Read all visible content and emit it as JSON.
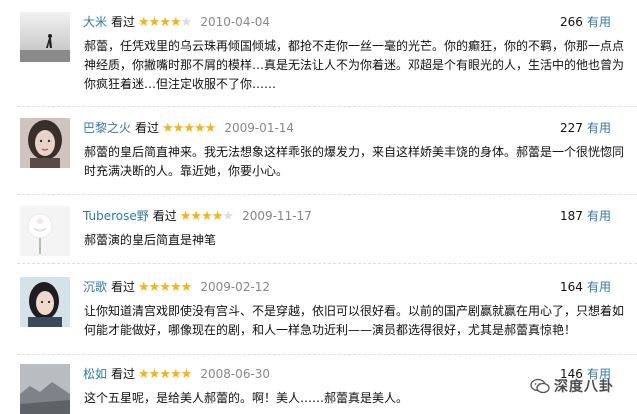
{
  "colors": {
    "link": "#3377aa",
    "star": "#f5b31b",
    "date": "#888888"
  },
  "reviews": [
    {
      "user": "大米",
      "seen": "看过",
      "stars": "★★★★",
      "stars_off": "★",
      "date": "2010-04-04",
      "votes": "266",
      "useful": "有用",
      "text": "郝蕾，任凭戏里的乌云珠再倾国倾城，都抢不走你一丝一毫的光芒。你的癫狂，你的不羁，你那一点点神经质，你撇嘴时那不屑的模样…真是无法让人不为你着迷。邓超是个有眼光的人，生活中的他也曾为你疯狂着迷…但注定收服不了你……",
      "avatar_icon": "person-silhouette-icon"
    },
    {
      "user": "巴黎之火",
      "seen": "看过",
      "stars": "★★★★★",
      "stars_off": "",
      "date": "2009-01-14",
      "votes": "227",
      "useful": "有用",
      "text": "郝蕾的皇后简直神来。我无法想象这样乖张的爆发力，来自这样娇美丰饶的身体。郝蕾是一个很恍惚同时充满决断的人。靠近她，你要小心。",
      "avatar_icon": "woman-portrait-icon"
    },
    {
      "user": "Tuberose野",
      "seen": "看过",
      "stars": "★★★★",
      "stars_off": "★",
      "date": "2009-11-17",
      "votes": "187",
      "useful": "有用",
      "text": "郝蕾演的皇后简直是神笔",
      "avatar_icon": "flower-icon"
    },
    {
      "user": "沉歌",
      "seen": "看过",
      "stars": "★★★★★",
      "stars_off": "",
      "date": "2009-02-12",
      "votes": "164",
      "useful": "有用",
      "text": "让你知道清宫戏即使没有宫斗、不是穿越，依旧可以很好看。以前的国产剧赢就赢在用心了，只想着如何能才能做好，哪像现在的剧，和人一样急功近利——演员都选得很好，尤其是郝蕾真惊艳！",
      "avatar_icon": "girl-portrait-icon"
    },
    {
      "user": "松如",
      "seen": "看过",
      "stars": "★★★★★",
      "stars_off": "",
      "date": "2008-06-30",
      "votes": "146",
      "useful": "有用",
      "text": "这个五星呢，是给美人郝蕾的。啊！美人……郝蕾真是美人。",
      "avatar_icon": "landscape-photo-icon"
    }
  ],
  "watermark": {
    "text": "深度八卦",
    "icon": "wechat-logo-icon"
  }
}
